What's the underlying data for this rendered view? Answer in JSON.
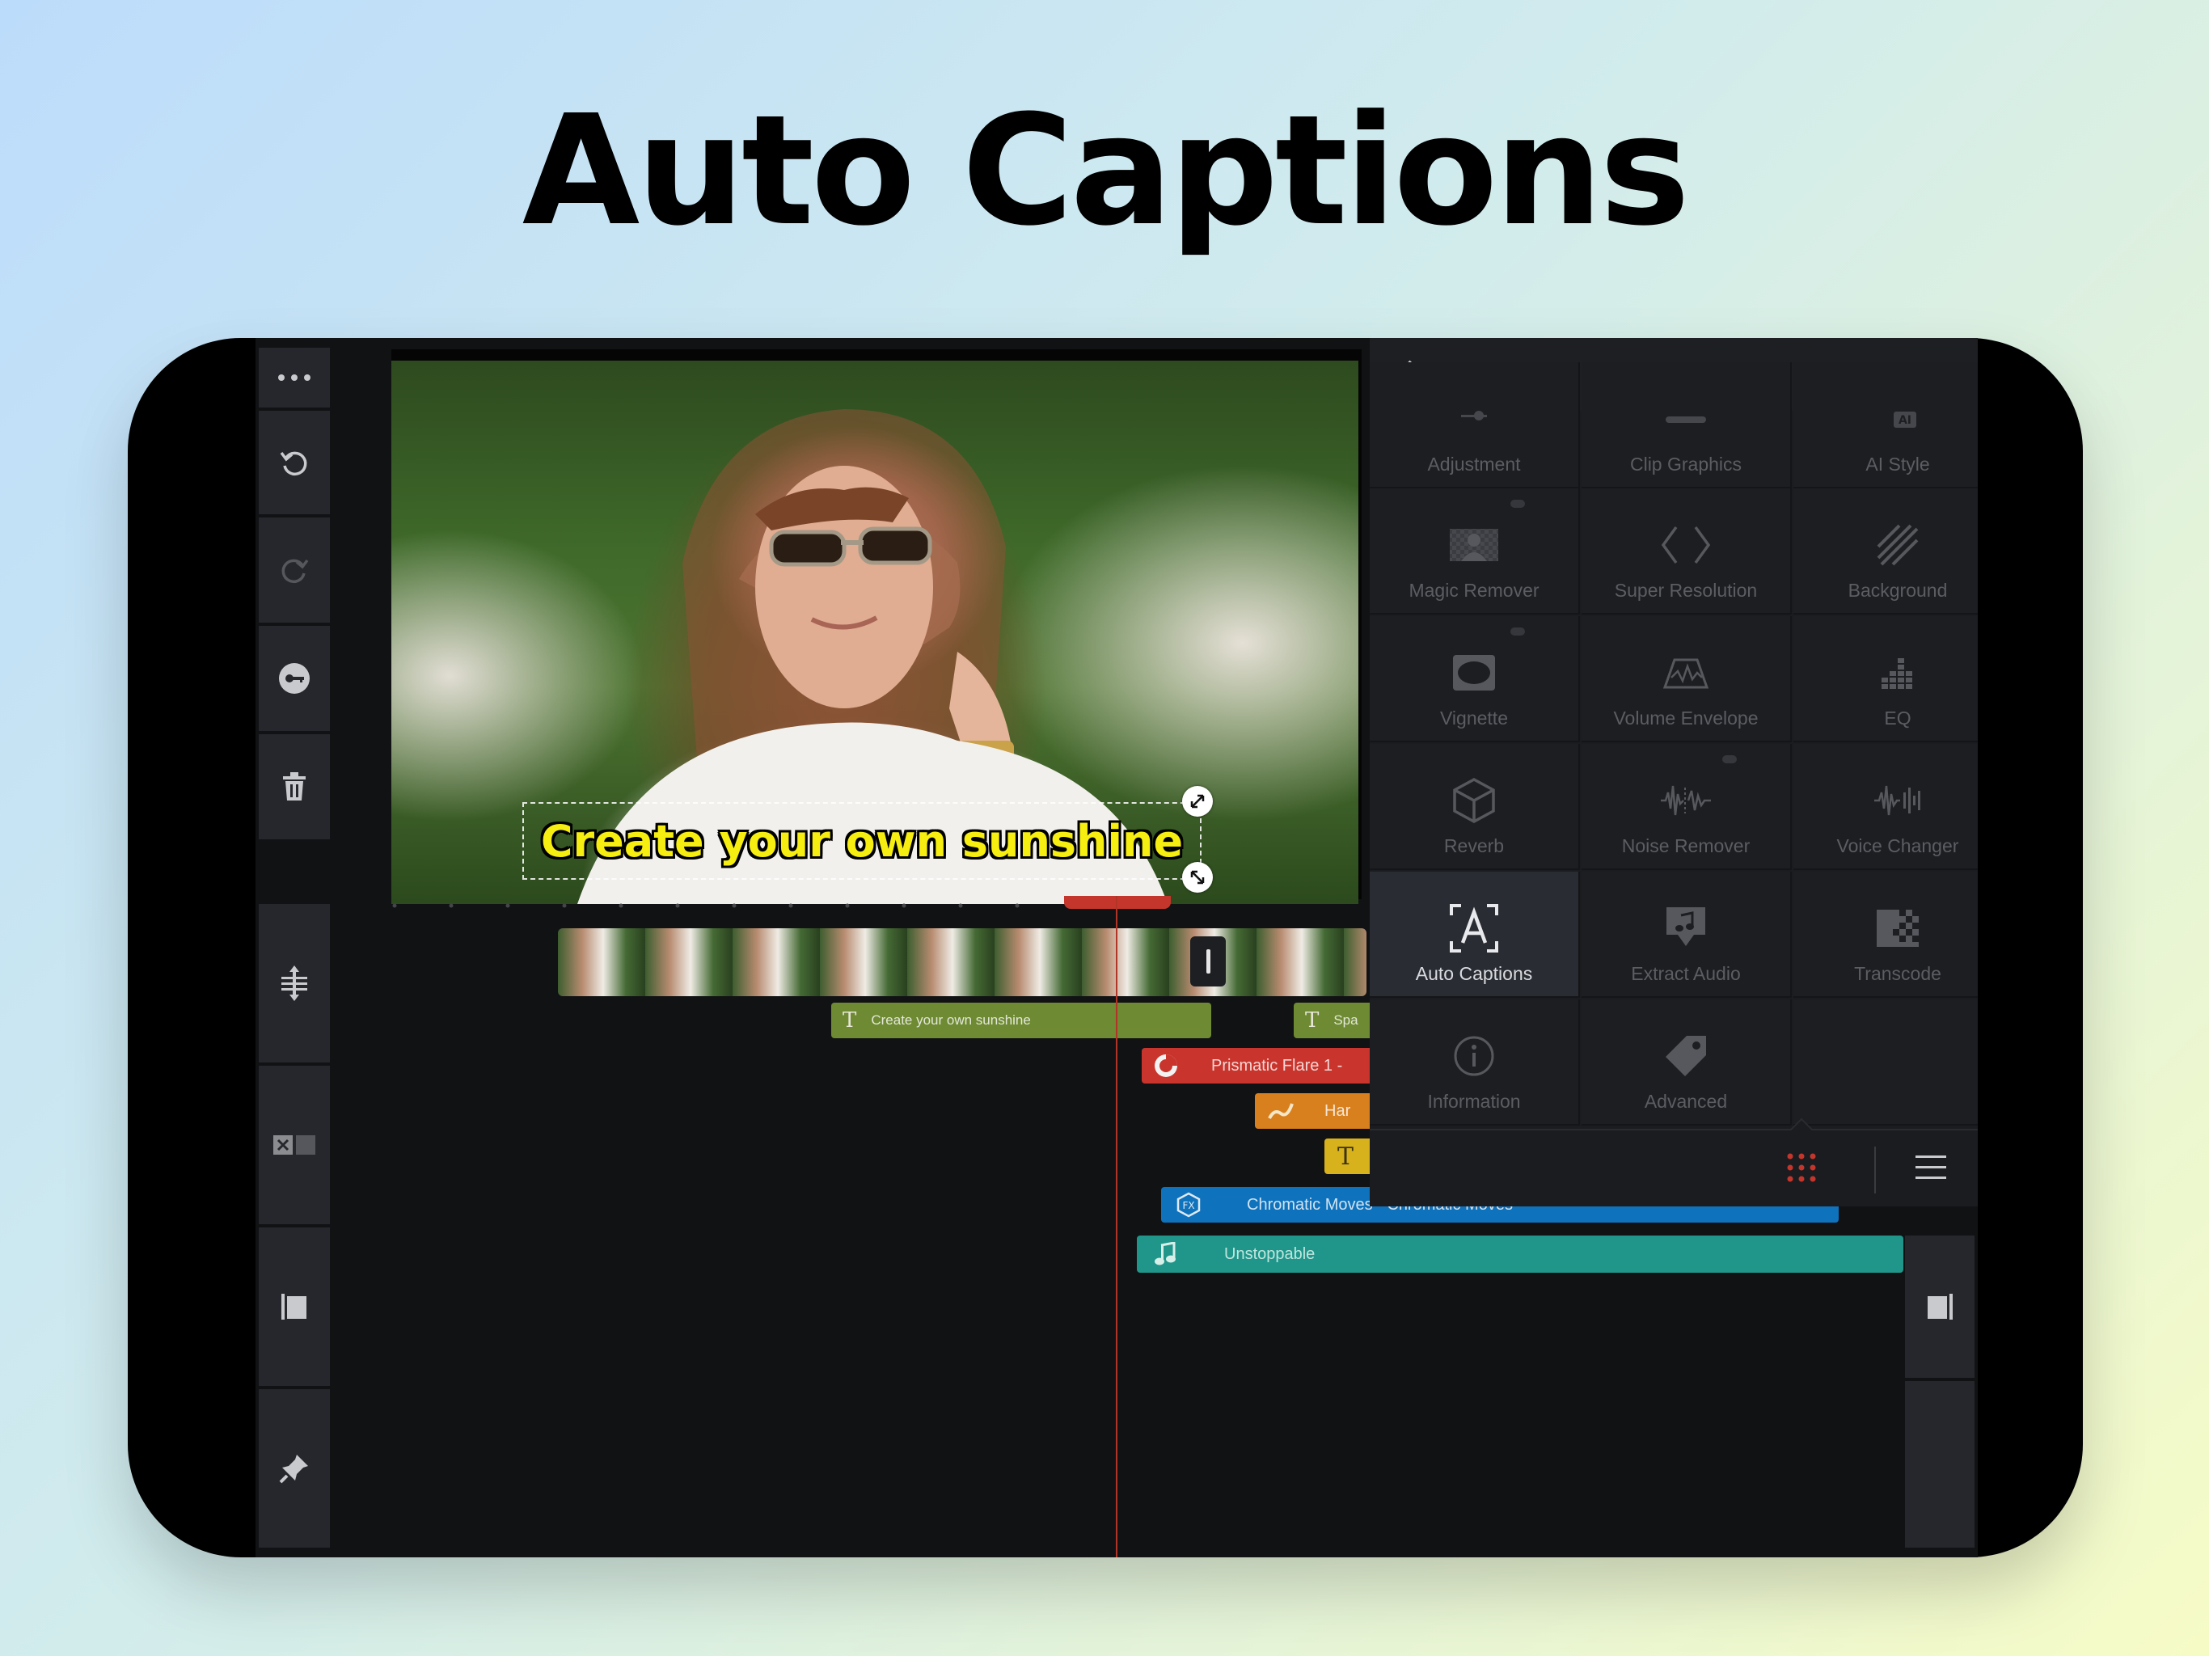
{
  "headline": "Auto Captions",
  "preview": {
    "caption": "Create your own sunshine"
  },
  "timeline": {
    "clips": [
      {
        "id": "text1",
        "label": "Create your own sunshine"
      },
      {
        "id": "text2",
        "label": "Spa"
      },
      {
        "id": "effect",
        "label": "Prismatic Flare 1 -"
      },
      {
        "id": "handwriting",
        "label": "Har"
      },
      {
        "id": "chromatic",
        "label": "Chromatic Moves - Chromatic Moves"
      },
      {
        "id": "audio",
        "label": "Unstoppable"
      }
    ]
  },
  "panel": {
    "items": [
      {
        "label": "Adjustment",
        "icon": "adjustment-icon"
      },
      {
        "label": "Clip Graphics",
        "icon": "clip-graphics-icon"
      },
      {
        "label": "AI Style",
        "icon": "ai-style-icon"
      },
      {
        "label": "Magic Remover",
        "icon": "magic-remover-icon"
      },
      {
        "label": "Super Resolution",
        "icon": "super-resolution-icon"
      },
      {
        "label": "Background",
        "icon": "background-icon"
      },
      {
        "label": "Vignette",
        "icon": "vignette-icon"
      },
      {
        "label": "Volume Envelope",
        "icon": "volume-envelope-icon"
      },
      {
        "label": "EQ",
        "icon": "eq-icon"
      },
      {
        "label": "Reverb",
        "icon": "reverb-icon"
      },
      {
        "label": "Noise Remover",
        "icon": "noise-remover-icon"
      },
      {
        "label": "Voice Changer",
        "icon": "voice-changer-icon"
      },
      {
        "label": "Auto Captions",
        "icon": "auto-captions-icon"
      },
      {
        "label": "Extract Audio",
        "icon": "extract-audio-icon"
      },
      {
        "label": "Transcode",
        "icon": "transcode-icon"
      },
      {
        "label": "Information",
        "icon": "information-icon"
      },
      {
        "label": "Advanced",
        "icon": "advanced-icon"
      }
    ]
  },
  "colors": {
    "accent": "#c4362b",
    "text_clip": "#6e8a33",
    "effect_clip": "#c9352d",
    "handwriting_clip": "#d9801e",
    "title_clip": "#d8b21c",
    "chromatic_clip": "#0f72bd",
    "audio_clip": "#20968a"
  }
}
